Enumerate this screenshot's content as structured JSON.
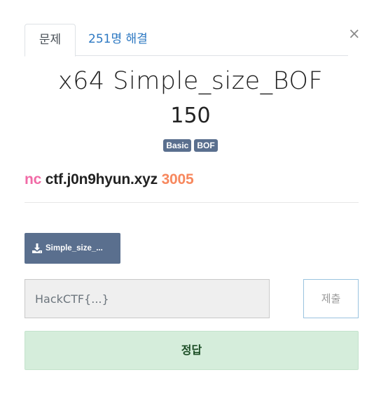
{
  "modal": {
    "close_glyph": "×"
  },
  "tabs": [
    {
      "label": "문제",
      "active": true
    },
    {
      "label": "251명 해결",
      "active": false
    }
  ],
  "challenge": {
    "title": "x64 Simple_size_BOF",
    "points": "150",
    "tags": [
      "Basic",
      "BOF"
    ],
    "connection": {
      "cmd": "nc",
      "host": "ctf.j0n9hyun.xyz",
      "port": "3005"
    }
  },
  "file": {
    "icon": "download-icon",
    "name": "Simple_size_..."
  },
  "flag_form": {
    "value": "",
    "placeholder": "HackCTF{...}",
    "submit_label": "제출"
  },
  "result": {
    "message": "정답",
    "status": "correct"
  },
  "colors": {
    "link": "#2c78c2",
    "tag_bg": "#5a6f8e",
    "cmd": "#f16aa6",
    "port": "#f7885e",
    "success_bg": "#d5eddb"
  }
}
